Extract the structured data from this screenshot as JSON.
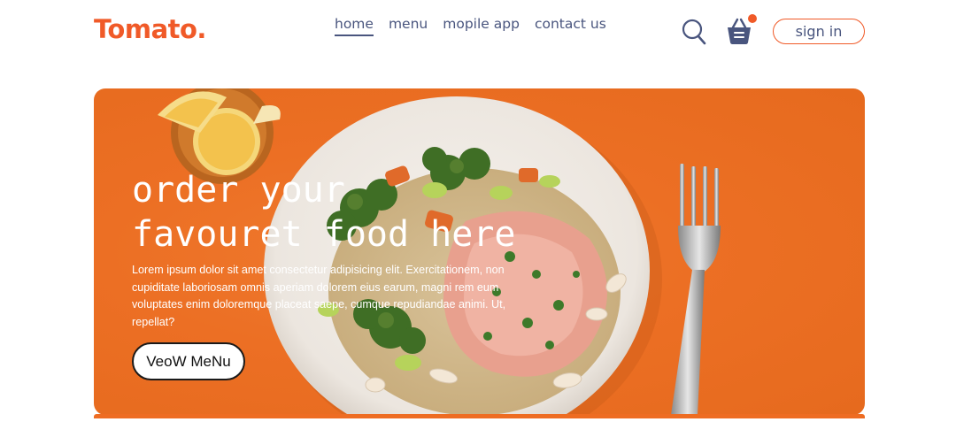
{
  "brand": {
    "logo": "Tomato.",
    "accent": "#f05a28",
    "text_color": "#49557e"
  },
  "nav": {
    "items": [
      {
        "label": "home",
        "active": true
      },
      {
        "label": "menu",
        "active": false
      },
      {
        "label": "mopile app",
        "active": false
      },
      {
        "label": "contact us",
        "active": false
      }
    ],
    "icons": [
      "search-icon",
      "basket-icon"
    ],
    "signin_label": "sign in"
  },
  "hero": {
    "title_line1": "order your",
    "title_line2": "favouret food here",
    "description": "Lorem ipsum dolor sit amet consectetur adipisicing elit. Exercitationem, non cupiditate laboriosam omnis aperiam dolorem eius earum, magni rem eum voluptates enim doloremque placeat saepe, cumque repudiandae animi. Ut, repellat?",
    "button_label": "VeoW MeNu",
    "background_color": "#ec6f24"
  }
}
